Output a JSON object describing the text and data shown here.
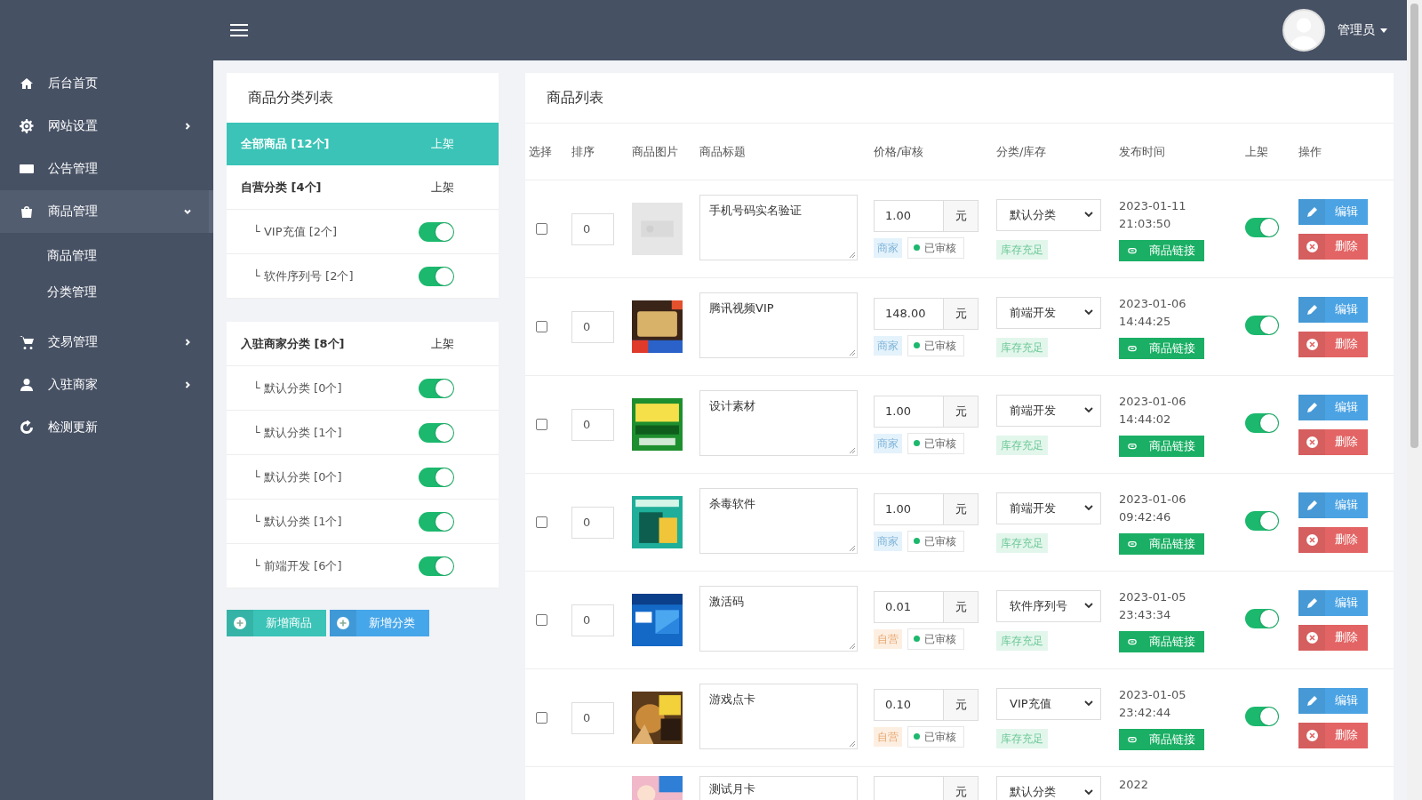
{
  "topbar": {
    "user": "管理员"
  },
  "sidebar": {
    "items": [
      {
        "label": "后台首页",
        "kind": "link",
        "selected": false
      },
      {
        "label": "网站设置",
        "kind": "menu",
        "selected": false,
        "expanded": false
      },
      {
        "label": "公告管理",
        "kind": "link",
        "selected": false
      },
      {
        "label": "商品管理",
        "kind": "menu",
        "selected": true,
        "expanded": true,
        "children": [
          {
            "label": "商品管理"
          },
          {
            "label": "分类管理"
          }
        ]
      },
      {
        "label": "交易管理",
        "kind": "menu",
        "selected": false,
        "expanded": false
      },
      {
        "label": "入驻商家",
        "kind": "menu",
        "selected": false,
        "expanded": false
      },
      {
        "label": "检测更新",
        "kind": "link",
        "selected": false
      }
    ]
  },
  "category_panel": {
    "title": "商品分类列表",
    "groups": [
      {
        "label": "全部商品 [12个]",
        "status": "上架",
        "selected": true
      },
      {
        "label": "自营分类 [4个]",
        "status": "上架",
        "selected": false,
        "children": [
          {
            "label": "└ VIP充值 [2个]",
            "on": true
          },
          {
            "label": "└ 软件序列号 [2个]",
            "on": true
          }
        ]
      },
      {
        "label": "入驻商家分类 [8个]",
        "status": "上架",
        "selected": false,
        "children": [
          {
            "label": "└ 默认分类 [0个]",
            "on": true
          },
          {
            "label": "└ 默认分类 [1个]",
            "on": true
          },
          {
            "label": "└ 默认分类 [0个]",
            "on": true
          },
          {
            "label": "└ 默认分类 [1个]",
            "on": true
          },
          {
            "label": "└ 前端开发 [6个]",
            "on": true
          }
        ]
      }
    ],
    "buttons": [
      {
        "label": "新增商品",
        "kind": "teal"
      },
      {
        "label": "新增分类",
        "kind": "blue"
      }
    ]
  },
  "product_panel": {
    "title": "商品列表",
    "columns": [
      "选择",
      "排序",
      "商品图片",
      "商品标题",
      "价格/审核",
      "分类/库存",
      "发布时间",
      "上架",
      "操作"
    ],
    "rows": [
      {
        "checked": false,
        "sort": "0",
        "title": "手机号码实名验证",
        "price": "1.00",
        "unit": "元",
        "seller": {
          "text": "商家",
          "kind": "merchant"
        },
        "review": "已审核",
        "category": "默认分类",
        "stock": "库存充足",
        "date": "2023-01-11",
        "time": "21:03:50",
        "link": "商品链接",
        "on": true,
        "edit": "编辑",
        "delete": "删除"
      },
      {
        "checked": false,
        "sort": "0",
        "title": "腾讯视频VIP",
        "price": "148.00",
        "unit": "元",
        "seller": {
          "text": "商家",
          "kind": "merchant"
        },
        "review": "已审核",
        "category": "前端开发",
        "stock": "库存充足",
        "date": "2023-01-06",
        "time": "14:44:25",
        "link": "商品链接",
        "on": true,
        "edit": "编辑",
        "delete": "删除"
      },
      {
        "checked": false,
        "sort": "0",
        "title": "设计素材",
        "price": "1.00",
        "unit": "元",
        "seller": {
          "text": "商家",
          "kind": "merchant"
        },
        "review": "已审核",
        "category": "前端开发",
        "stock": "库存充足",
        "date": "2023-01-06",
        "time": "14:44:02",
        "link": "商品链接",
        "on": true,
        "edit": "编辑",
        "delete": "删除"
      },
      {
        "checked": false,
        "sort": "0",
        "title": "杀毒软件",
        "price": "1.00",
        "unit": "元",
        "seller": {
          "text": "商家",
          "kind": "merchant"
        },
        "review": "已审核",
        "category": "前端开发",
        "stock": "库存充足",
        "date": "2023-01-06",
        "time": "09:42:46",
        "link": "商品链接",
        "on": true,
        "edit": "编辑",
        "delete": "删除"
      },
      {
        "checked": false,
        "sort": "0",
        "title": "激活码",
        "price": "0.01",
        "unit": "元",
        "seller": {
          "text": "自营",
          "kind": "self"
        },
        "review": "已审核",
        "category": "软件序列号",
        "stock": "库存充足",
        "date": "2023-01-05",
        "time": "23:43:34",
        "link": "商品链接",
        "on": true,
        "edit": "编辑",
        "delete": "删除"
      },
      {
        "checked": false,
        "sort": "0",
        "title": "游戏点卡",
        "price": "0.10",
        "unit": "元",
        "seller": {
          "text": "自营",
          "kind": "self"
        },
        "review": "已审核",
        "category": "VIP充值",
        "stock": "库存充足",
        "date": "2023-01-05",
        "time": "23:42:44",
        "link": "商品链接",
        "on": true,
        "edit": "编辑",
        "delete": "删除"
      },
      {
        "title": "测试月卡",
        "unit": "元",
        "category": "默认分类",
        "date": "2022"
      }
    ]
  }
}
